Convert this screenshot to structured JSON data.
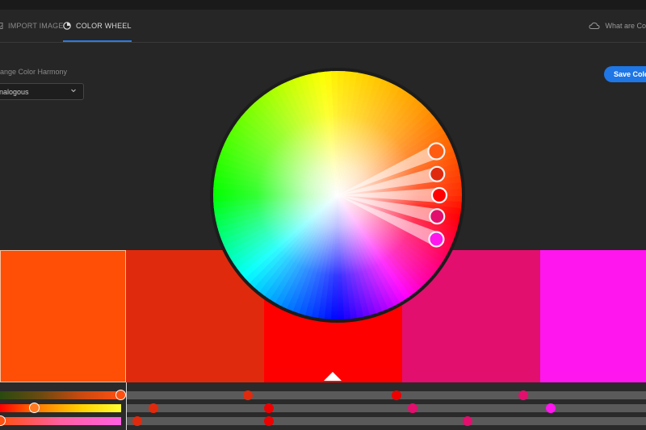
{
  "tabs": {
    "import_label": "IMPORT IMAGE",
    "wheel_label": "COLOR WHEEL",
    "help_label": "What are Co"
  },
  "harmony": {
    "label": "ange Color Harmony",
    "value": "nalogous"
  },
  "save_label": "Save Color",
  "colors": {
    "accent": "#1f76e5",
    "background": "#262626"
  },
  "swatches": [
    "#ff4f07",
    "#e02a0d",
    "#ff0000",
    "#e20f6e",
    "#ff16ef"
  ],
  "selected_swatch": 0,
  "wheel": {
    "handles": [
      {
        "hue_deg": 22,
        "color": "#ff5c12"
      },
      {
        "hue_deg": 10,
        "color": "#e02a0d"
      },
      {
        "hue_deg": 0,
        "color": "#ff0000"
      },
      {
        "hue_deg": 340,
        "color": "#e20f6e"
      },
      {
        "hue_deg": 310,
        "color": "#ff16ef"
      }
    ]
  },
  "icons": {
    "import": "image-icon",
    "wheel": "color-wheel-icon",
    "help": "cloud-icon",
    "dropdown": "chevron-down-icon"
  }
}
